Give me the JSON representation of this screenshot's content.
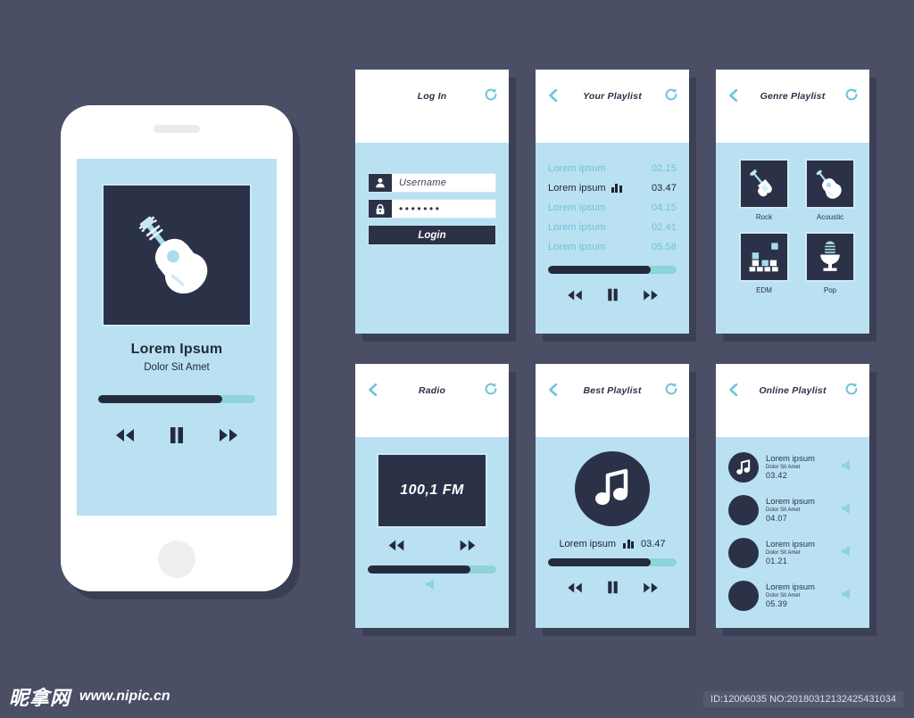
{
  "canvas": {
    "background_color": "#4a4f66",
    "panel_body_color": "#b9e1f2",
    "panel_header_color": "#ffffff",
    "dark_navy": "#2b3247",
    "teal_accent": "#8ed4d8",
    "muted_track_color": "#6ec2d4"
  },
  "phone": {
    "name": "music-player-phone",
    "album_art_icon": "acoustic-guitar-icon",
    "song_title": "Lorem Ipsum",
    "song_subtitle": "Dolor Sit Amet",
    "progress_percent": 79,
    "controls": [
      {
        "name": "rewind-button",
        "glyph": "rewind"
      },
      {
        "name": "pause-button",
        "glyph": "pause"
      },
      {
        "name": "forward-button",
        "glyph": "forward"
      }
    ]
  },
  "screens": {
    "login": {
      "title": "Log In",
      "has_back": false,
      "refresh_icon": "refresh-icon",
      "username_icon": "user-icon",
      "username_value": "Username",
      "password_icon": "lock-icon",
      "password_value": "•••••••",
      "login_button": "Login"
    },
    "your_playlist": {
      "title": "Your Playlist",
      "back_icon": "back-chevron-icon",
      "refresh_icon": "refresh-icon",
      "tracks": [
        {
          "label": "Lorem ipsum",
          "time": "02.15",
          "active": false
        },
        {
          "label": "Lorem ipsum",
          "time": "03.47",
          "active": true
        },
        {
          "label": "Lorem ipsum",
          "time": "04.15",
          "active": false
        },
        {
          "label": "Lorem ipsum",
          "time": "02.41",
          "active": false
        },
        {
          "label": "Lorem ipsum",
          "time": "05.58",
          "active": false
        }
      ],
      "progress_percent": 80,
      "controls": [
        {
          "name": "rewind-button",
          "glyph": "rewind"
        },
        {
          "name": "pause-button",
          "glyph": "pause"
        },
        {
          "name": "forward-button",
          "glyph": "forward"
        }
      ]
    },
    "genre_playlist": {
      "title": "Genre Playlist",
      "back_icon": "back-chevron-icon",
      "refresh_icon": "refresh-icon",
      "genres": [
        {
          "label": "Rock",
          "icon": "electric-guitar-icon"
        },
        {
          "label": "Acoustic",
          "icon": "acoustic-guitar-icon"
        },
        {
          "label": "EDM",
          "icon": "equalizer-blocks-icon"
        },
        {
          "label": "Pop",
          "icon": "microphone-icon"
        }
      ]
    },
    "radio": {
      "title": "Radio",
      "back_icon": "back-chevron-icon",
      "refresh_icon": "refresh-icon",
      "frequency": "100,1 FM",
      "controls": [
        {
          "name": "rewind-button",
          "glyph": "rewind"
        },
        {
          "name": "forward-button",
          "glyph": "forward"
        }
      ],
      "volume_percent": 80,
      "volume_icon": "speaker-icon"
    },
    "best_playlist": {
      "title": "Best Playlist",
      "back_icon": "back-chevron-icon",
      "refresh_icon": "refresh-icon",
      "artwork_icon": "music-note-icon",
      "track_label": "Lorem ipsum",
      "track_time": "03.47",
      "progress_percent": 80,
      "controls": [
        {
          "name": "rewind-button",
          "glyph": "rewind"
        },
        {
          "name": "pause-button",
          "glyph": "pause"
        },
        {
          "name": "forward-button",
          "glyph": "forward"
        }
      ]
    },
    "online_playlist": {
      "title": "Online Playlist",
      "back_icon": "back-chevron-icon",
      "refresh_icon": "refresh-icon",
      "items": [
        {
          "title": "Lorem ipsum",
          "subtitle": "Dolor Sit Amet",
          "time": "03.42",
          "has_note": true
        },
        {
          "title": "Lorem ipsum",
          "subtitle": "Dolor Sit Amet",
          "time": "04.07",
          "has_note": false
        },
        {
          "title": "Lorem ipsum",
          "subtitle": "Dolor Sit Amet",
          "time": "01.21",
          "has_note": false
        },
        {
          "title": "Lorem ipsum",
          "subtitle": "Dolor Sit Amet",
          "time": "05.39",
          "has_note": false
        }
      ],
      "row_icon": "speaker-icon"
    }
  },
  "footer": {
    "watermark_cn": "昵拿网",
    "watermark_url": "www.nipic.cn",
    "id_text": "ID:12006035 NO:20180312132425431034"
  }
}
